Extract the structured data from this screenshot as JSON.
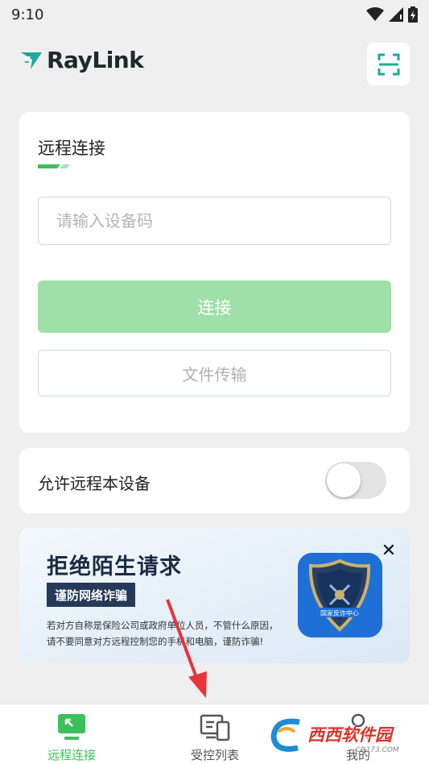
{
  "status_bar": {
    "time": "9:10"
  },
  "app": {
    "brand_name": "RayLink",
    "brand_color": "#1fa99a",
    "accent_color": "#3cc05a"
  },
  "header": {
    "scan_icon": "scan-frame-icon"
  },
  "remote_card": {
    "title": "远程连接",
    "code_input_placeholder": "请输入设备码",
    "code_input_value": "",
    "connect_label": "连接",
    "file_transfer_label": "文件传输"
  },
  "allow_card": {
    "label": "允许远程本设备",
    "toggle_on": false
  },
  "banner": {
    "title": "拒绝陌生请求",
    "tag": "谨防网络诈骗",
    "desc_line1": "若对方自称是保险公司或政府单位人员，不管什么原因，",
    "desc_line2": "请不要同意对方远程控制您的手机和电脑，谨防诈骗!",
    "badge_text": "国家反诈中心",
    "close_icon": "close-icon"
  },
  "nav": {
    "items": [
      {
        "label": "远程连接",
        "icon": "remote-connect-icon",
        "active": true
      },
      {
        "label": "受控列表",
        "icon": "device-list-icon",
        "active": false
      },
      {
        "label": "我的",
        "icon": "profile-icon",
        "active": false
      }
    ]
  },
  "watermark": {
    "text": "西西软件园",
    "small": "CR173.COM"
  }
}
